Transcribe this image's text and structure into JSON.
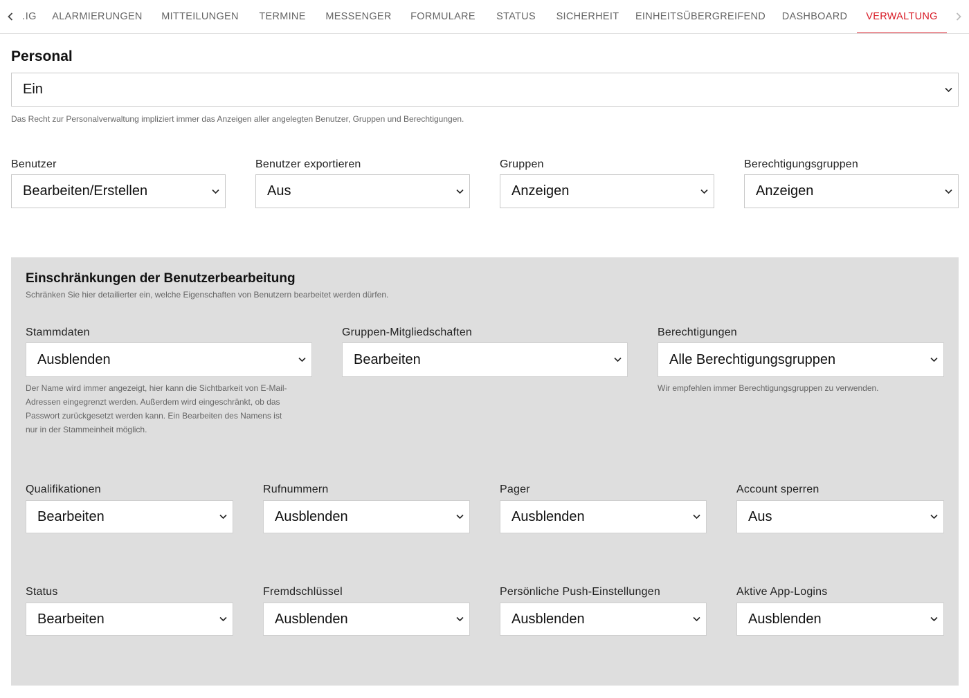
{
  "tabs": [
    {
      "label": "…IG",
      "active": false
    },
    {
      "label": "ALARMIERUNGEN",
      "active": false
    },
    {
      "label": "MITTEILUNGEN",
      "active": false
    },
    {
      "label": "TERMINE",
      "active": false
    },
    {
      "label": "MESSENGER",
      "active": false
    },
    {
      "label": "FORMULARE",
      "active": false
    },
    {
      "label": "STATUS",
      "active": false
    },
    {
      "label": "SICHERHEIT",
      "active": false
    },
    {
      "label": "EINHEITSÜBERGREIFEND",
      "active": false
    },
    {
      "label": "DASHBOARD",
      "active": false
    },
    {
      "label": "VERWALTUNG",
      "active": true
    }
  ],
  "icons": {
    "left": "chevron-left-icon",
    "right": "chevron-right-icon",
    "select": "chevron-down-icon"
  },
  "colors": {
    "accent": "#d81b26",
    "panel_bg": "#dedede"
  },
  "personal": {
    "title": "Personal",
    "value": "Ein",
    "hint": "Das Recht zur Personalverwaltung impliziert immer das Anzeigen aller angelegten Benutzer, Gruppen und Berechtigungen."
  },
  "top_fields": [
    {
      "label": "Benutzer",
      "value": "Bearbeiten/Erstellen"
    },
    {
      "label": "Benutzer exportieren",
      "value": "Aus"
    },
    {
      "label": "Gruppen",
      "value": "Anzeigen"
    },
    {
      "label": "Berechtigungsgruppen",
      "value": "Anzeigen"
    }
  ],
  "restrictions": {
    "title": "Einschränkungen der Benutzerbearbeitung",
    "subtitle": "Schränken Sie hier detailierter ein, welche Eigenschaften von Benutzern bearbeitet werden dürfen.",
    "row1": [
      {
        "label": "Stammdaten",
        "value": "Ausblenden",
        "hint_lines": [
          "Der Name wird immer angezeigt, hier kann die Sichtbarkeit von E-Mail-",
          "Adressen eingegrenzt werden. Außerdem wird eingeschränkt, ob das",
          "Passwort zurückgesetzt werden kann. Ein Bearbeiten des Namens ist",
          "nur in der Stammeinheit möglich."
        ]
      },
      {
        "label": "Gruppen-Mitgliedschaften",
        "value": "Bearbeiten"
      },
      {
        "label": "Berechtigungen",
        "value": "Alle Berechtigungsgruppen",
        "hint": "Wir empfehlen immer Berechtigungsgruppen zu verwenden."
      }
    ],
    "row2": [
      {
        "label": "Qualifikationen",
        "value": "Bearbeiten"
      },
      {
        "label": "Rufnummern",
        "value": "Ausblenden"
      },
      {
        "label": "Pager",
        "value": "Ausblenden"
      },
      {
        "label": "Account sperren",
        "value": "Aus"
      }
    ],
    "row3": [
      {
        "label": "Status",
        "value": "Bearbeiten"
      },
      {
        "label": "Fremdschlüssel",
        "value": "Ausblenden"
      },
      {
        "label": "Persönliche Push-Einstellungen",
        "value": "Ausblenden"
      },
      {
        "label": "Aktive App-Logins",
        "value": "Ausblenden"
      }
    ]
  }
}
